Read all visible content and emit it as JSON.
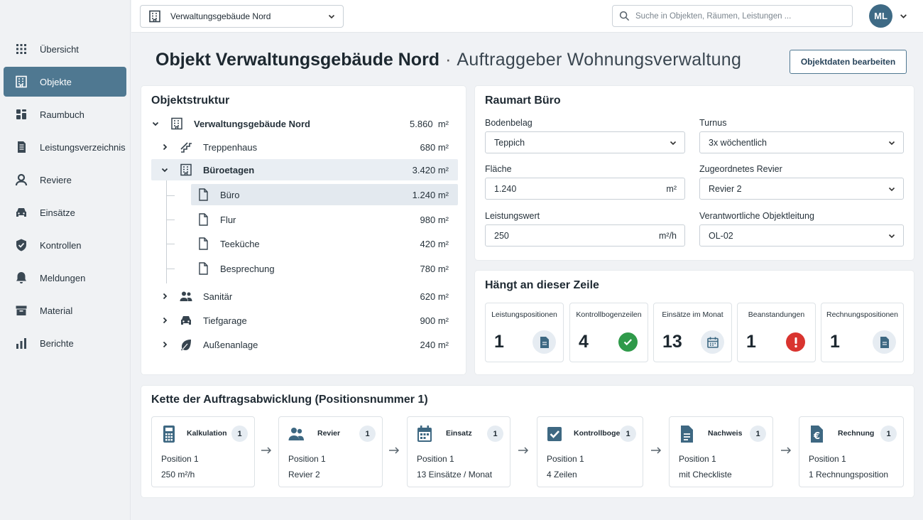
{
  "topbar": {
    "object_select": "Verwaltungsgebäude Nord",
    "search_placeholder": "Suche in Objekten, Räumen, Leistungen ...",
    "avatar_initials": "ML"
  },
  "sidebar": {
    "items": [
      {
        "label": "Übersicht",
        "icon": "grid-icon"
      },
      {
        "label": "Objekte",
        "icon": "building-icon",
        "active": true
      },
      {
        "label": "Raumbuch",
        "icon": "book-icon"
      },
      {
        "label": "Leistungsverzeichnis",
        "icon": "checklist-icon"
      },
      {
        "label": "Reviere",
        "icon": "person-icon"
      },
      {
        "label": "Einsätze",
        "icon": "car-icon"
      },
      {
        "label": "Kontrollen",
        "icon": "shield-icon"
      },
      {
        "label": "Meldungen",
        "icon": "bell-icon"
      },
      {
        "label": "Material",
        "icon": "box-icon"
      },
      {
        "label": "Berichte",
        "icon": "bar-chart-icon"
      }
    ]
  },
  "header": {
    "prefix": "Objekt",
    "name": "Verwaltungsgebäude Nord",
    "separator": "·",
    "client": "Auftraggeber Wohnungsverwaltung",
    "edit_button": "Objektdaten bearbeiten"
  },
  "structure": {
    "title": "Objektstruktur",
    "rows": [
      {
        "label": "Verwaltungsgebäude Nord",
        "area": "5.860",
        "icon": "building-icon",
        "level": 0,
        "expand": "expanded"
      },
      {
        "label": "Treppenhaus",
        "area": "680",
        "icon": "stairs-icon",
        "level": 1,
        "expand": "collapsed"
      },
      {
        "label": "Büroetagen",
        "area": "3.420",
        "icon": "building-icon",
        "level": 1,
        "expand": "expanded",
        "highlight": true
      },
      {
        "label": "Büro",
        "area": "1.240",
        "icon": "document-icon",
        "level": 2,
        "highlight": true
      },
      {
        "label": "Flur",
        "area": "980",
        "icon": "document-icon",
        "level": 2
      },
      {
        "label": "Teeküche",
        "area": "420",
        "icon": "document-icon",
        "level": 2
      },
      {
        "label": "Besprechung",
        "area": "780",
        "icon": "document-icon",
        "level": 2
      },
      {
        "label": "Sanitär",
        "area": "620",
        "icon": "people-icon",
        "level": 1,
        "expand": "collapsed"
      },
      {
        "label": "Tiefgarage",
        "area": "900",
        "icon": "car-icon",
        "level": 1,
        "expand": "collapsed"
      },
      {
        "label": "Außenanlage",
        "area": "240",
        "icon": "leaf-icon",
        "level": 1,
        "expand": "collapsed"
      }
    ],
    "unit": "m²"
  },
  "room_type": {
    "title": "Raumart Büro",
    "floor_label": "Bodenbelag",
    "floor_value": "Teppich",
    "cycle_label": "Turnus",
    "cycle_value": "3x wöchentlich",
    "area_label": "Fläche",
    "area_value": "1.240",
    "area_unit": "m²",
    "district_label": "Zugeordnetes Revier",
    "district_value": "Revier 2",
    "rate_label": "Leistungswert",
    "rate_value": "250",
    "rate_unit": "m²/h",
    "manager_label": "Verantwortliche Objektleitung",
    "manager_value": "OL-02"
  },
  "dependencies": {
    "title": "Hängt an dieser Zeile",
    "stats": [
      {
        "label": "Leistungspositionen",
        "value": "1",
        "icon": "document-icon",
        "kind": "info"
      },
      {
        "label": "Kontrollbogenzeilen",
        "value": "4",
        "icon": "check-circle-icon",
        "kind": "ok"
      },
      {
        "label": "Einsätze im Monat",
        "value": "13",
        "icon": "calendar-icon",
        "kind": "info"
      },
      {
        "label": "Beanstandungen",
        "value": "1",
        "icon": "alert-icon",
        "kind": "err"
      },
      {
        "label": "Rechnungspositionen",
        "value": "1",
        "icon": "document-icon",
        "kind": "info"
      }
    ]
  },
  "chain": {
    "title": "Kette der Auftragsabwicklung (Positionsnummer 1)",
    "steps": [
      {
        "name": "Kalkulation",
        "count": "1",
        "line1": "Position 1",
        "line2": "250 m²/h",
        "icon": "calculator-icon"
      },
      {
        "name": "Revier",
        "count": "1",
        "line1": "Position 1",
        "line2": "Revier 2",
        "icon": "people-icon"
      },
      {
        "name": "Einsatz",
        "count": "1",
        "line1": "Position 1",
        "line2": "13 Einsätze / Monat",
        "icon": "calendar-icon"
      },
      {
        "name": "Kontrollbogen",
        "count": "1",
        "line1": "Position 1",
        "line2": "4 Zeilen",
        "icon": "checkbox-icon"
      },
      {
        "name": "Nachweis",
        "count": "1",
        "line1": "Position 1",
        "line2": "mit Checkliste",
        "icon": "document-icon"
      },
      {
        "name": "Rechnung",
        "count": "1",
        "line1": "Position 1",
        "line2": "1 Rechnungsposition",
        "icon": "euro-document-icon"
      }
    ]
  },
  "colors": {
    "accent": "#4f7891",
    "success": "#2f9a4a",
    "danger": "#d9342f"
  }
}
